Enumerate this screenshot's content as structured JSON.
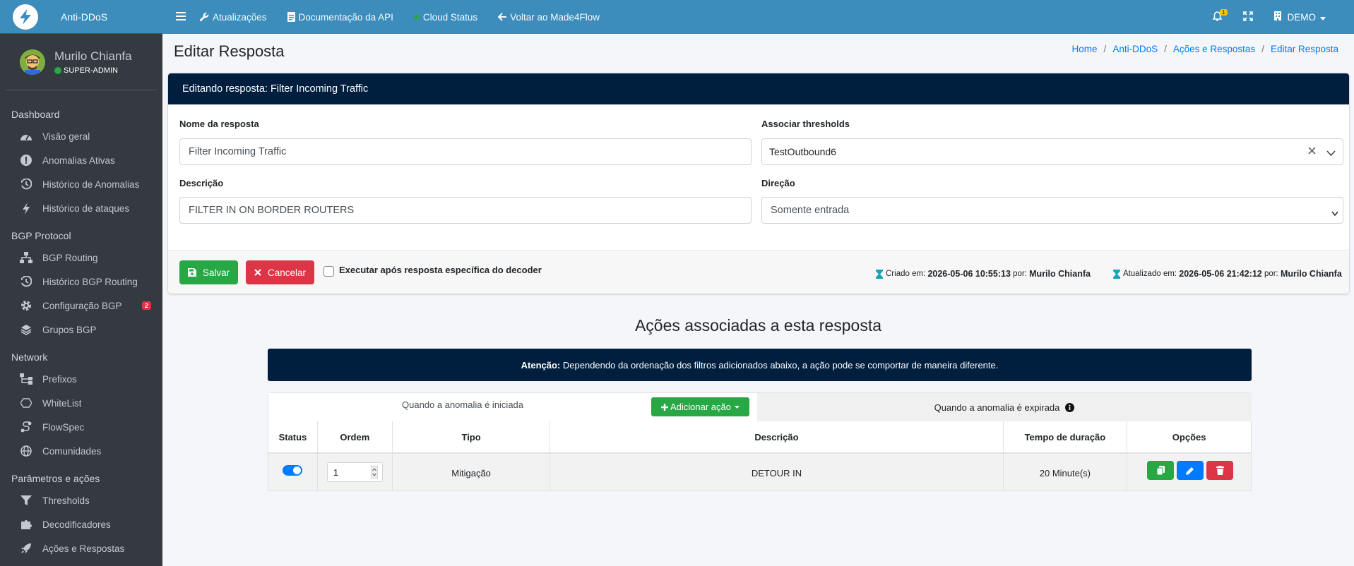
{
  "brand": {
    "name": "Anti-DDoS",
    "accent": "#3c8dbc"
  },
  "user": {
    "name": "Murilo Chianfa",
    "role": "SUPER-ADMIN"
  },
  "sidebar": {
    "sections": [
      {
        "header": "Dashboard",
        "items": [
          {
            "label": "Visão geral",
            "icon": "gauge-icon"
          },
          {
            "label": "Anomalias Ativas",
            "icon": "exclamation-circle-icon"
          },
          {
            "label": "Histórico de Anomalias",
            "icon": "history-icon"
          },
          {
            "label": "Histórico de ataques",
            "icon": "bolt-icon"
          }
        ]
      },
      {
        "header": "BGP Protocol",
        "items": [
          {
            "label": "BGP Routing",
            "icon": "sitemap-icon"
          },
          {
            "label": "Histórico BGP Routing",
            "icon": "history-icon"
          },
          {
            "label": "Configuração BGP",
            "icon": "gear-icon",
            "badge": "2"
          },
          {
            "label": "Grupos BGP",
            "icon": "layers-icon"
          }
        ]
      },
      {
        "header": "Network",
        "items": [
          {
            "label": "Prefixos",
            "icon": "network-icon"
          },
          {
            "label": "WhiteList",
            "icon": "hexagon-icon"
          },
          {
            "label": "FlowSpec",
            "icon": "route-icon"
          },
          {
            "label": "Comunidades",
            "icon": "globe-icon"
          }
        ]
      },
      {
        "header": "Parâmetros e ações",
        "items": [
          {
            "label": "Thresholds",
            "icon": "filter-icon"
          },
          {
            "label": "Decodificadores",
            "icon": "puzzle-icon"
          },
          {
            "label": "Ações e Respostas",
            "icon": "rocket-icon"
          }
        ]
      }
    ]
  },
  "topbar": {
    "links": [
      "Atualizações",
      "Documentação da API",
      "Cloud Status",
      "Voltar ao Made4Flow"
    ],
    "bell_count": "1",
    "org": "DEMO"
  },
  "page": {
    "title": "Editar Resposta",
    "breadcrumb": [
      "Home",
      "Anti-DDoS",
      "Ações e Respostas",
      "Editar Resposta"
    ]
  },
  "form": {
    "header": "Editando resposta: Filter Incoming Traffic",
    "name_label": "Nome da resposta",
    "name_value": "Filter Incoming Traffic",
    "thresholds_label": "Associar thresholds",
    "thresholds_value": "TestOutbound6",
    "desc_label": "Descrição",
    "desc_value": "FILTER IN ON BORDER ROUTERS",
    "direction_label": "Direção",
    "direction_value": "Somente entrada",
    "save": "Salvar",
    "cancel": "Cancelar",
    "exec_after": "Executar após resposta específica do decoder",
    "created_label": "Criado em:",
    "created_at": "2026-05-06 10:55:13",
    "created_by_label": "por:",
    "created_by": "Murilo Chianfa",
    "updated_label": "Atualizado em:",
    "updated_at": "2026-05-06 21:42:12",
    "updated_by_label": "por:",
    "updated_by": "Murilo Chianfa"
  },
  "actions": {
    "title": "Ações associadas a esta resposta",
    "alert_bold": "Atenção:",
    "alert_text": "Dependendo da ordenação dos filtros adicionados abaixo, a ação pode se comportar de maneira diferente.",
    "tab_started": "Quando a anomalia é iniciada",
    "add_action": "Adicionar ação",
    "tab_expired": "Quando a anomalia é expirada",
    "columns": [
      "Status",
      "Ordem",
      "Tipo",
      "Descrição",
      "Tempo de duração",
      "Opções"
    ],
    "rows": [
      {
        "status": true,
        "order": "1",
        "type": "Mitigação",
        "description": "DETOUR IN",
        "duration": "20 Minute(s)"
      }
    ]
  }
}
